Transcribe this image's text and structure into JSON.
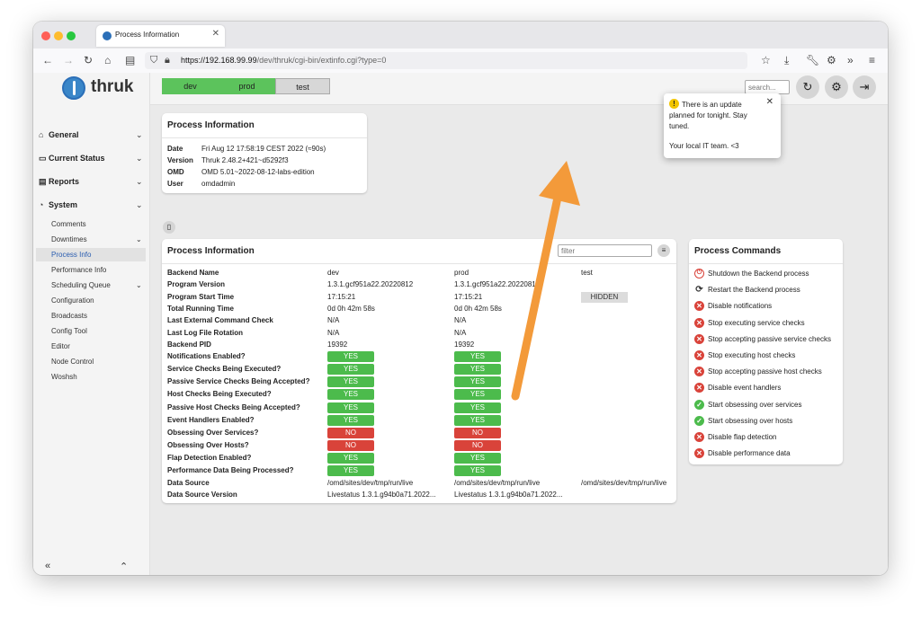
{
  "browser": {
    "tab_title": "Process Information",
    "url_host": "https://192.168.99.99",
    "url_path": "/dev/thruk/cgi-bin/extinfo.cgi?type=0"
  },
  "logo": {
    "text": "thruk"
  },
  "sidebar": {
    "sections": [
      {
        "label": "General",
        "icon": "home-icon"
      },
      {
        "label": "Current Status",
        "icon": "monitor-icon"
      },
      {
        "label": "Reports",
        "icon": "document-icon"
      },
      {
        "label": "System",
        "icon": "gauge-icon"
      }
    ],
    "system_items": [
      "Comments",
      "Downtimes",
      "Process Info",
      "Performance Info",
      "Scheduling Queue",
      "Configuration",
      "Broadcasts",
      "Config Tool",
      "Editor",
      "Node Control",
      "Woshsh"
    ],
    "active_item": "Process Info"
  },
  "topbar": {
    "backends": [
      {
        "label": "dev",
        "color": "#5cc35c"
      },
      {
        "label": "prod",
        "color": "#5cc35c"
      },
      {
        "label": "test",
        "color": "#d7d7d7"
      }
    ],
    "search_placeholder": "search..."
  },
  "notice": {
    "message": "There is an update planned for tonight. Stay tuned.",
    "signature": "Your local IT team. <3"
  },
  "info_card": {
    "title": "Process Information",
    "rows": [
      {
        "key": "Date",
        "value": "Fri Aug 12 17:58:19 CEST 2022 (≈90s)"
      },
      {
        "key": "Version",
        "value": "Thruk 2.48.2+421~d5292f3"
      },
      {
        "key": "OMD",
        "value": "OMD 5.01~2022-08-12-labs-edition"
      },
      {
        "key": "User",
        "value": "omdadmin"
      }
    ]
  },
  "process_card": {
    "title": "Process Information",
    "filter_placeholder": "filter",
    "backends": [
      "dev",
      "prod",
      "test"
    ],
    "text_rows": [
      {
        "label": "Backend Name",
        "values": [
          "dev",
          "prod",
          "test"
        ]
      },
      {
        "label": "Program Version",
        "values": [
          "1.3.1.gcf951a22.20220812",
          "1.3.1.gcf951a22.20220812",
          ""
        ]
      },
      {
        "label": "Program Start Time",
        "values": [
          "17:15:21",
          "17:15:21",
          ""
        ]
      },
      {
        "label": "Total Running Time",
        "values": [
          "0d 0h 42m 58s",
          "0d 0h 42m 58s",
          ""
        ]
      },
      {
        "label": "Last External Command Check",
        "values": [
          "N/A",
          "N/A",
          ""
        ]
      },
      {
        "label": "Last Log File Rotation",
        "values": [
          "N/A",
          "N/A",
          ""
        ]
      },
      {
        "label": "Backend PID",
        "values": [
          "19392",
          "19392",
          ""
        ]
      }
    ],
    "hidden_label": "HIDDEN",
    "flag_rows": [
      {
        "label": "Notifications Enabled?",
        "values": [
          "YES",
          "YES"
        ]
      },
      {
        "label": "Service Checks Being Executed?",
        "values": [
          "YES",
          "YES"
        ]
      },
      {
        "label": "Passive Service Checks Being Accepted?",
        "values": [
          "YES",
          "YES"
        ]
      },
      {
        "label": "Host Checks Being Executed?",
        "values": [
          "YES",
          "YES"
        ]
      },
      {
        "label": "Passive Host Checks Being Accepted?",
        "values": [
          "YES",
          "YES"
        ]
      },
      {
        "label": "Event Handlers Enabled?",
        "values": [
          "YES",
          "YES"
        ]
      },
      {
        "label": "Obsessing Over Services?",
        "values": [
          "NO",
          "NO"
        ]
      },
      {
        "label": "Obsessing Over Hosts?",
        "values": [
          "NO",
          "NO"
        ]
      },
      {
        "label": "Flap Detection Enabled?",
        "values": [
          "YES",
          "YES"
        ]
      },
      {
        "label": "Performance Data Being Processed?",
        "values": [
          "YES",
          "YES"
        ]
      }
    ],
    "tail_rows": [
      {
        "label": "Data Source",
        "values": [
          "/omd/sites/dev/tmp/run/live",
          "/omd/sites/dev/tmp/run/live",
          "/omd/sites/dev/tmp/run/live"
        ]
      },
      {
        "label": "Data Source Version",
        "values": [
          "Livestatus 1.3.1.g94b0a71.2022...",
          "Livestatus 1.3.1.g94b0a71.2022...",
          ""
        ]
      }
    ]
  },
  "commands_card": {
    "title": "Process Commands",
    "items": [
      {
        "label": "Shutdown the Backend process",
        "icon": "power-icon",
        "kind": "power"
      },
      {
        "label": "Restart the Backend process",
        "icon": "refresh-icon",
        "kind": "plain"
      },
      {
        "label": "Disable notifications",
        "icon": "x-circle-icon",
        "kind": "red"
      },
      {
        "label": "Stop executing service checks",
        "icon": "x-circle-icon",
        "kind": "red"
      },
      {
        "label": "Stop accepting passive service checks",
        "icon": "x-circle-icon",
        "kind": "red"
      },
      {
        "label": "Stop executing host checks",
        "icon": "x-circle-icon",
        "kind": "red"
      },
      {
        "label": "Stop accepting passive host checks",
        "icon": "x-circle-icon",
        "kind": "red"
      },
      {
        "label": "Disable event handlers",
        "icon": "x-circle-icon",
        "kind": "red"
      },
      {
        "label": "Start obsessing over services",
        "icon": "check-circle-icon",
        "kind": "green"
      },
      {
        "label": "Start obsessing over hosts",
        "icon": "check-circle-icon",
        "kind": "green"
      },
      {
        "label": "Disable flap detection",
        "icon": "x-circle-icon",
        "kind": "red"
      },
      {
        "label": "Disable performance data",
        "icon": "x-circle-icon",
        "kind": "red"
      }
    ]
  },
  "colors": {
    "yes": "#4cbb4c",
    "no": "#d9433a",
    "arrow": "#f39a3a",
    "link_active": "#2a5db0"
  }
}
